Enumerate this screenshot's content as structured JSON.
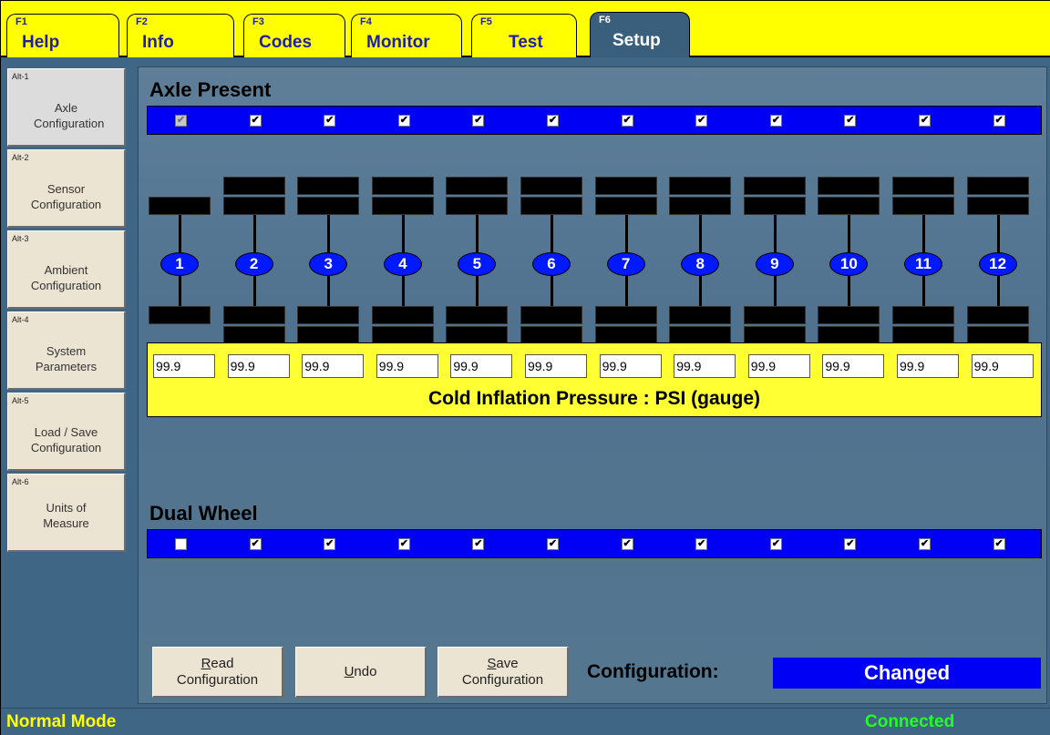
{
  "tabs": [
    {
      "key": "F1",
      "label": "Help"
    },
    {
      "key": "F2",
      "label": "Info"
    },
    {
      "key": "F3",
      "label": "Codes"
    },
    {
      "key": "F4",
      "label": "Monitor"
    },
    {
      "key": "F5",
      "label": "Test"
    },
    {
      "key": "F6",
      "label": "Setup",
      "active": true
    }
  ],
  "sidebar": {
    "items": [
      {
        "key": "Alt-1",
        "label": "Axle Configuration",
        "active": true
      },
      {
        "key": "Alt-2",
        "label": "Sensor Configuration"
      },
      {
        "key": "Alt-3",
        "label": "Ambient Configuration"
      },
      {
        "key": "Alt-4",
        "label": "System Parameters"
      },
      {
        "key": "Alt-5",
        "label": "Load / Save Configuration"
      },
      {
        "key": "Alt-6",
        "label": "Units of Measure"
      }
    ]
  },
  "axle_present": {
    "title": "Axle Present",
    "checks": [
      true,
      true,
      true,
      true,
      true,
      true,
      true,
      true,
      true,
      true,
      true,
      true
    ],
    "first_disabled": true
  },
  "axles": {
    "labels": [
      "1",
      "2",
      "3",
      "4",
      "5",
      "6",
      "7",
      "8",
      "9",
      "10",
      "11",
      "12"
    ],
    "dual": [
      false,
      true,
      true,
      true,
      true,
      true,
      true,
      true,
      true,
      true,
      true,
      true
    ]
  },
  "pressure": {
    "values": [
      "99.9",
      "99.9",
      "99.9",
      "99.9",
      "99.9",
      "99.9",
      "99.9",
      "99.9",
      "99.9",
      "99.9",
      "99.9",
      "99.9"
    ],
    "label": "Cold Inflation Pressure : PSI (gauge)"
  },
  "dual_wheel": {
    "title": "Dual Wheel",
    "checks": [
      false,
      true,
      true,
      true,
      true,
      true,
      true,
      true,
      true,
      true,
      true,
      true
    ]
  },
  "buttons": {
    "read": {
      "mnemonic": "R",
      "line1_rest": "ead",
      "line2": "Configuration"
    },
    "undo": {
      "mnemonic": "U",
      "rest": "ndo"
    },
    "save": {
      "mnemonic": "S",
      "line1_rest": "ave",
      "line2": "Configuration"
    }
  },
  "configuration": {
    "label": "Configuration:",
    "status": "Changed"
  },
  "status_bar": {
    "mode": "Normal Mode",
    "connection": "Connected"
  },
  "colors": {
    "tab_bg": "#ffff00",
    "tab_text": "#1e1eaa",
    "panel": "#3f6685",
    "blue_bar": "#0000f4",
    "axle_pill": "#0019ff",
    "connected": "#22ff22"
  }
}
